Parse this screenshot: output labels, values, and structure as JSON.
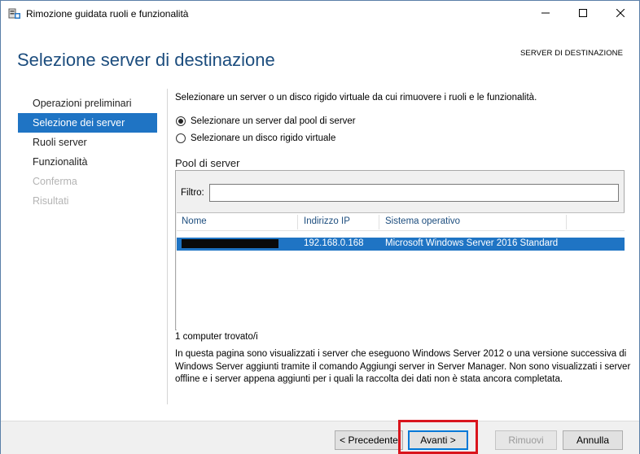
{
  "window": {
    "title": "Rimozione guidata ruoli e funzionalità",
    "controls": [
      "minimize-icon",
      "maximize-icon",
      "close-icon"
    ]
  },
  "header": {
    "page_title": "Selezione server di destinazione",
    "destination_label": "SERVER DI DESTINAZIONE"
  },
  "nav": {
    "items": [
      {
        "label": "Operazioni preliminari",
        "state": "normal"
      },
      {
        "label": "Selezione dei server",
        "state": "active"
      },
      {
        "label": "Ruoli server",
        "state": "normal"
      },
      {
        "label": "Funzionalità",
        "state": "normal"
      },
      {
        "label": "Conferma",
        "state": "disabled"
      },
      {
        "label": "Risultati",
        "state": "disabled"
      }
    ]
  },
  "main": {
    "intro": "Selezionare un server o un disco rigido virtuale da cui rimuovere i ruoli e le funzionalità.",
    "radio_options": [
      {
        "label": "Selezionare un server dal pool di server",
        "checked": true
      },
      {
        "label": "Selezionare un disco rigido virtuale",
        "checked": false
      }
    ],
    "pool_title": "Pool di server",
    "filter_label": "Filtro:",
    "filter_value": "",
    "columns": [
      "Nome",
      "Indirizzo IP",
      "Sistema operativo"
    ],
    "rows": [
      {
        "name": "",
        "ip": "192.168.0.168",
        "os": "Microsoft Windows Server 2016 Standard",
        "selected": true,
        "name_redacted": true
      }
    ],
    "found_text": "1 computer trovato/i",
    "description": "In questa pagina sono visualizzati i server che eseguono Windows Server 2012 o una versione successiva di Windows Server aggiunti tramite il comando Aggiungi server in Server Manager. Non sono visualizzati i server offline e i server appena aggiunti per i quali la raccolta dei dati non è stata ancora completata."
  },
  "footer": {
    "prev_label": "< Precedente",
    "next_label": "Avanti >",
    "remove_label": "Rimuovi",
    "cancel_label": "Annulla"
  },
  "colors": {
    "accent": "#1f74c4",
    "title": "#1c4d7e",
    "highlight": "#d9141c",
    "disabled": "#b4b4b4"
  }
}
